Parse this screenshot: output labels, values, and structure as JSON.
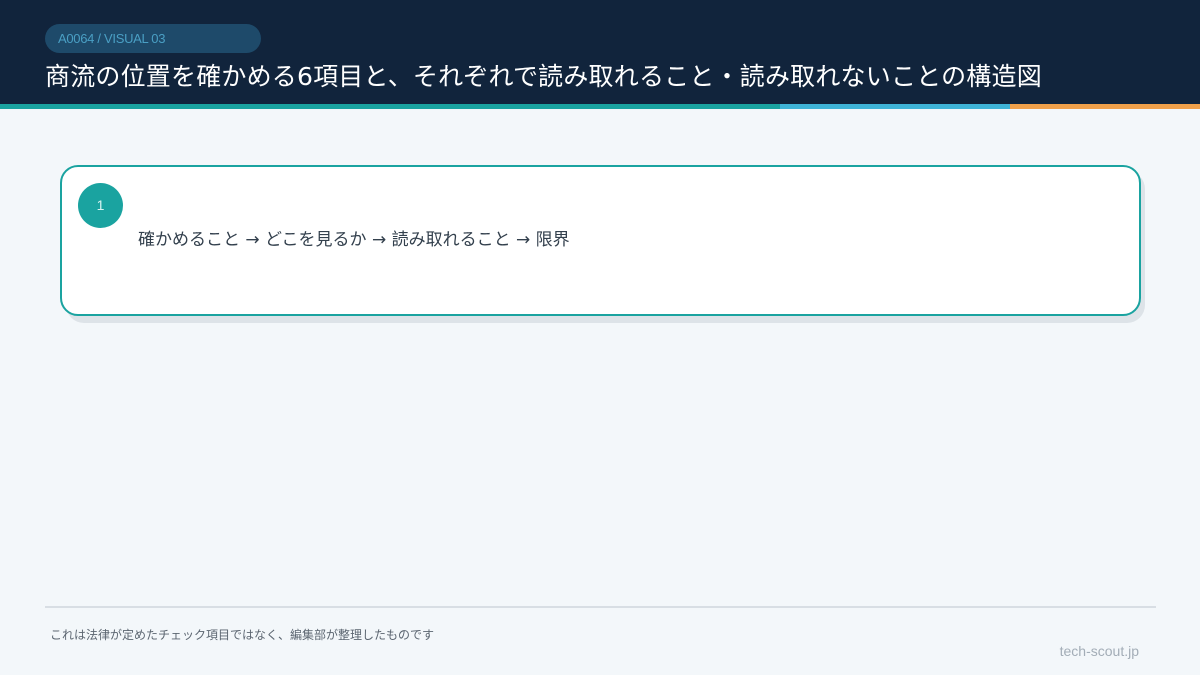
{
  "header": {
    "badge": "A0064 / VISUAL 03",
    "title": "商流の位置を確かめる6項目と、それぞれで読み取れること・読み取れないことの構造図"
  },
  "card": {
    "number": "1",
    "text": "確かめること → どこを見るか → 読み取れること → 限界"
  },
  "footer": {
    "note": "これは法律が定めたチェック項目ではなく、編集部が整理したものです",
    "site": "tech-scout.jp"
  },
  "colors": {
    "header_bg": "#11243c",
    "accent_teal": "#1aa3a0",
    "accent_blue": "#3fb4d8",
    "accent_orange": "#f0a04a"
  }
}
